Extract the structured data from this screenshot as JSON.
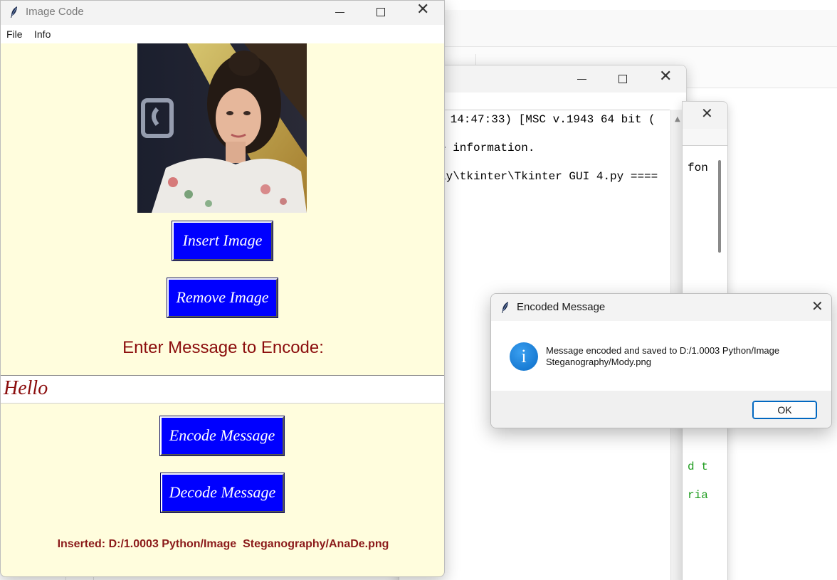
{
  "main_window": {
    "title": "Image Code",
    "menu": {
      "file": "File",
      "info": "Info"
    },
    "buttons": {
      "insert": "Insert Image",
      "remove": "Remove Image",
      "encode": "Encode Message",
      "decode": "Decode Message"
    },
    "prompt": "Enter Message to Encode:",
    "message_value": "Hello",
    "status": "Inserted: D:/1.0003 Python/Image  Steganography/AnaDe.png"
  },
  "dialog": {
    "title": "Encoded Message",
    "message": "Message encoded and saved to D:/1.0003 Python/Image Steganography/Mody.png",
    "ok_label": "OK",
    "icon": "info-icon"
  },
  "shell": {
    "lines": [
      " 14:47:33) [MSC v.1943 64 bit (",
      "e information.",
      "ay\\tkinter\\Tkinter GUI 4.py ===="
    ]
  },
  "config": {
    "fragments": [
      "fon",
      "d t",
      "ria"
    ]
  },
  "colors": {
    "button_bg": "#0000ff",
    "window_bg": "#fffddd",
    "accent_text": "#8b0d0d",
    "dialog_accent": "#0067c0"
  }
}
